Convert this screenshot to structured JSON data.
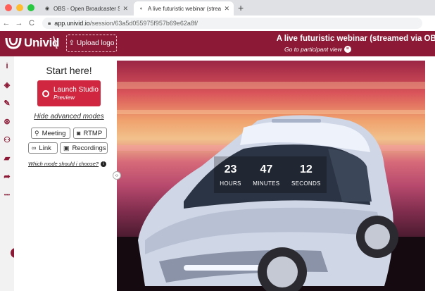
{
  "browser": {
    "tabs": [
      {
        "title": "OBS - Open Broadcaster Softw",
        "active": false,
        "icon": "obs-icon"
      },
      {
        "title": "A live futuristic webinar (strea",
        "active": true,
        "icon": "univid-icon"
      }
    ],
    "new_tab": "+",
    "back": "←",
    "forward": "→",
    "reload": "C",
    "url_host": "app.univid.io",
    "url_path": "/session/63a5d055975f957b69e62a8f/"
  },
  "header": {
    "logo_text": "Univid",
    "slash": "\\",
    "upload_logo": "Upload logo",
    "webinar_title": "A live futuristic webinar (streamed via OBS)",
    "participant_link": "Go to participant view"
  },
  "sidebar": {
    "items": [
      {
        "name": "info-icon",
        "glyph": "i"
      },
      {
        "name": "shapes-icon",
        "glyph": "◈"
      },
      {
        "name": "brush-icon",
        "glyph": "✎"
      },
      {
        "name": "fingerprint-icon",
        "glyph": "⊛"
      },
      {
        "name": "users-icon",
        "glyph": "⚇"
      },
      {
        "name": "toolbox-icon",
        "glyph": "▰"
      },
      {
        "name": "share-icon",
        "glyph": "➦"
      },
      {
        "name": "more-icon",
        "glyph": "•••"
      }
    ],
    "toggle": "›"
  },
  "panel": {
    "start": "Start here!",
    "launch_label": "Launch Studio",
    "launch_sub": "Preview",
    "hide_modes": "Hide advanced modes",
    "modes": [
      {
        "id": "meeting",
        "label": "Meeting",
        "icon": "pin-icon",
        "glyph": "⚲"
      },
      {
        "id": "rtmp",
        "label": "RTMP",
        "icon": "camera-icon",
        "glyph": "◙"
      },
      {
        "id": "link",
        "label": "Link",
        "icon": "link-icon",
        "glyph": "∞"
      },
      {
        "id": "recordings",
        "label": "Recordings",
        "icon": "film-icon",
        "glyph": "▣"
      }
    ],
    "which_mode": "Which mode should i choose?",
    "info_glyph": "i"
  },
  "handle_glyph": "‹›",
  "countdown": {
    "hours": "23",
    "hours_label": "HOURS",
    "minutes": "47",
    "minutes_label": "MINUTES",
    "seconds": "12",
    "seconds_label": "SECONDS"
  },
  "colors": {
    "brand": "#8c1a36",
    "launch": "#d0263f"
  }
}
